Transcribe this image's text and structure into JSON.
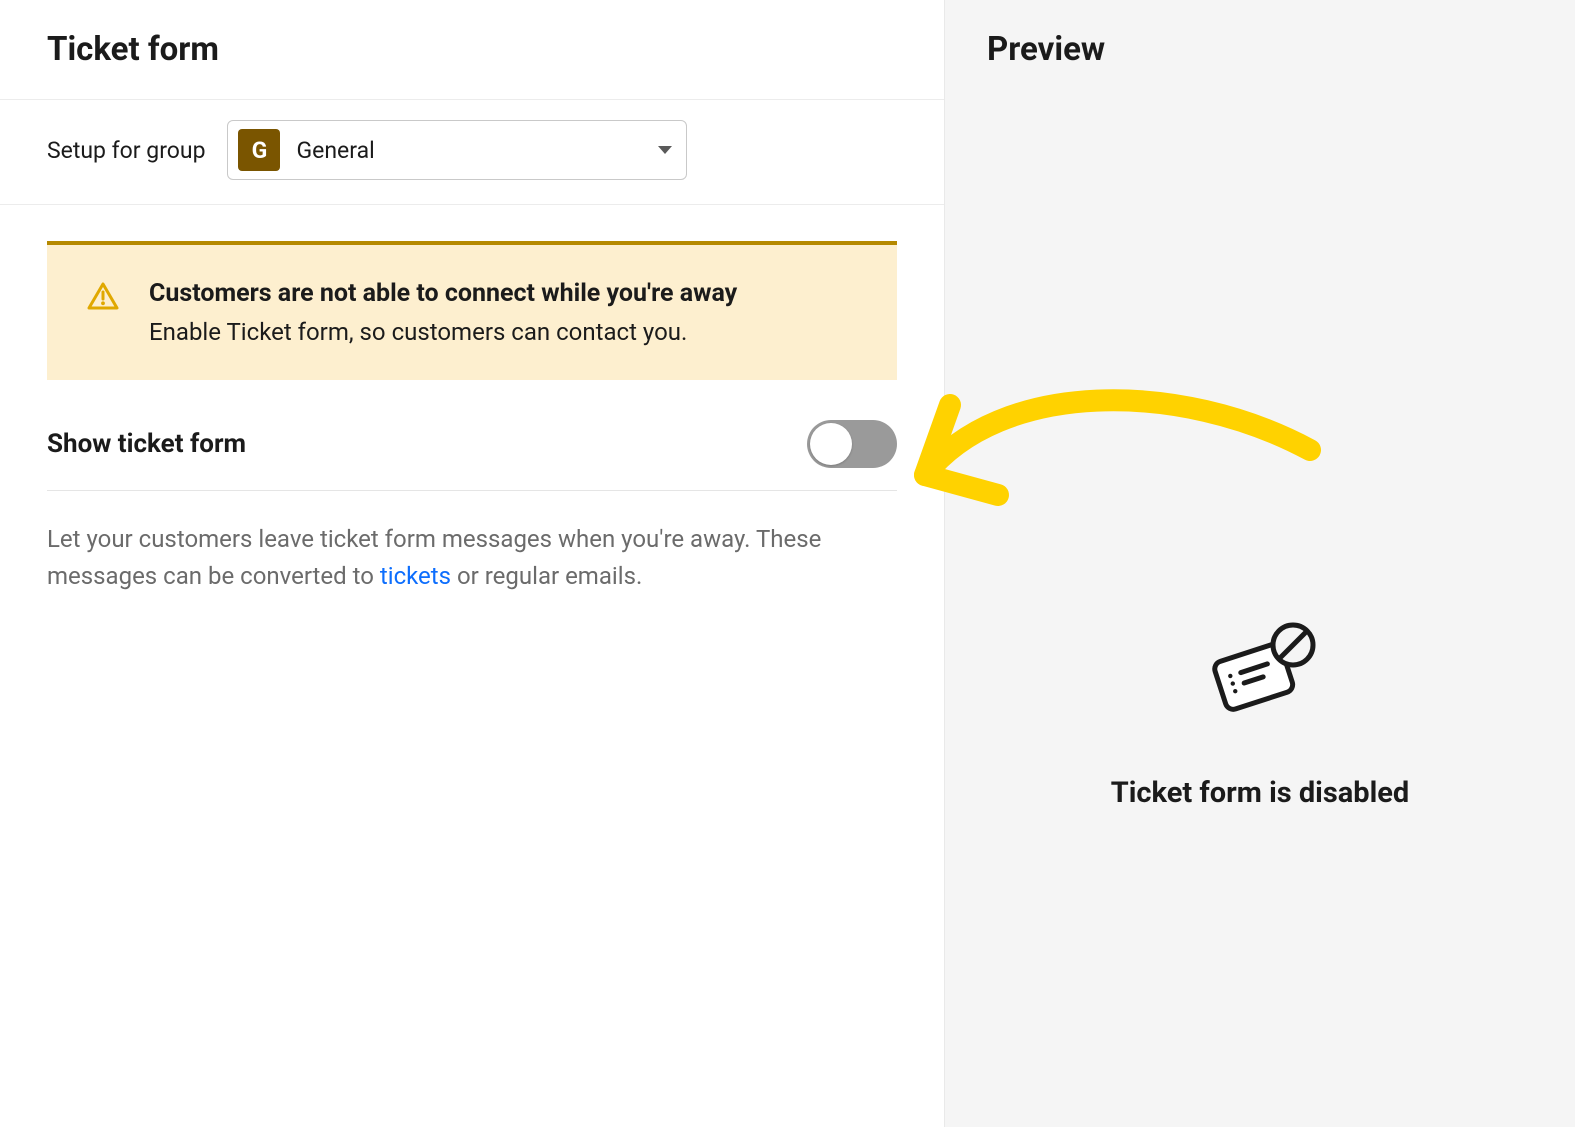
{
  "panel": {
    "title": "Ticket form"
  },
  "group": {
    "label": "Setup for group",
    "badge": "G",
    "selected": "General"
  },
  "warning": {
    "title": "Customers are not able to connect while you're away",
    "body": "Enable Ticket form, so customers can contact you."
  },
  "toggle": {
    "label": "Show ticket form",
    "state": "off"
  },
  "description": {
    "before": "Let your customers leave ticket form messages when you're away. These messages can be converted to ",
    "link": "tickets",
    "after": " or regular emails."
  },
  "preview": {
    "title": "Preview",
    "disabled_text": "Ticket form is disabled"
  },
  "colors": {
    "accent": "#ffd200",
    "warning_border": "#b58900",
    "warning_bg": "#fdefcf",
    "badge_bg": "#7a5500",
    "link": "#0d6efd",
    "toggle_off": "#9a9a9a"
  }
}
